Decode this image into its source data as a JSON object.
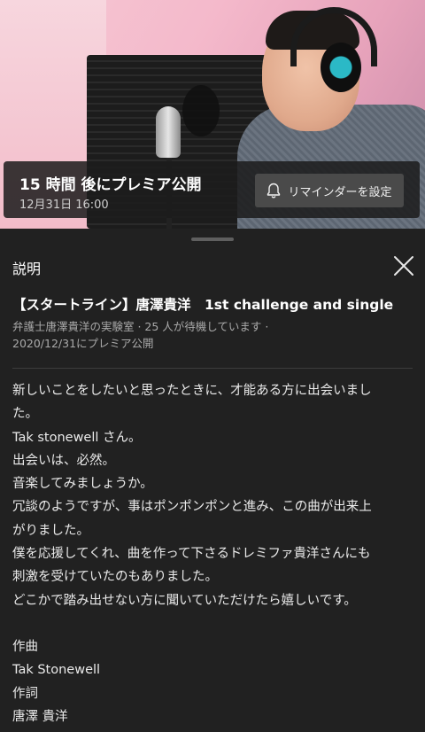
{
  "premiere": {
    "title": "15 時間 後にプレミア公開",
    "date": "12月31日 16:00",
    "reminder_label": "リマインダーを設定"
  },
  "sheet": {
    "title": "説明"
  },
  "video": {
    "title": "【スタートライン】唐澤貴洋　1st challenge and single",
    "meta_line1": "弁護士唐澤貴洋の実験室 · 25 人が待機しています ·",
    "meta_line2": "2020/12/31にプレミア公開"
  },
  "description": {
    "lines": [
      "新しいことをしたいと思ったときに、才能ある方に出会いまし",
      "た。",
      "Tak stonewell さん。",
      "出会いは、必然。",
      "音楽してみましょうか。",
      "冗談のようですが、事はポンポンポンと進み、この曲が出来上",
      "がりました。",
      "僕を応援してくれ、曲を作って下さるドレミファ貴洋さんにも",
      "刺激を受けていたのもありました。",
      "どこかで踏み出せない方に聞いていただけたら嬉しいです。",
      "",
      "作曲",
      "Tak Stonewell",
      "作詞",
      "唐澤 貴洋"
    ]
  },
  "icons": {
    "bell": "bell-icon",
    "close": "close-icon"
  },
  "colors": {
    "background": "#212121",
    "overlay": "#1c1c1c",
    "button": "#4a4a4a",
    "secondary_text": "#aaaaaa"
  }
}
